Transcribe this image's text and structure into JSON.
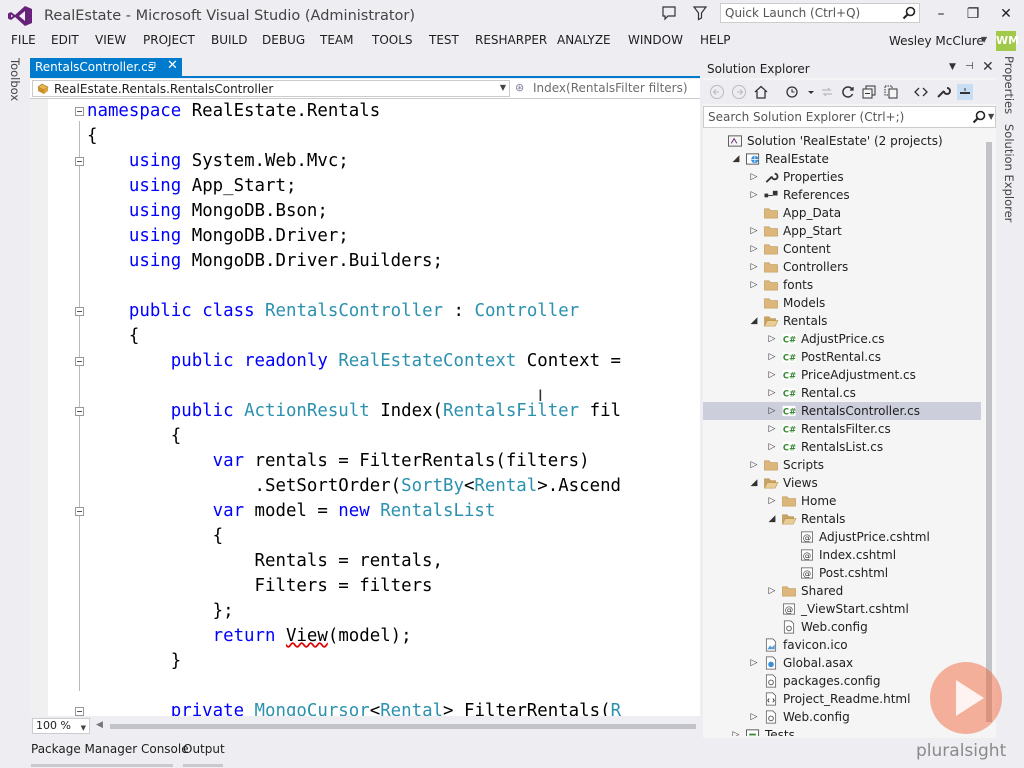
{
  "window": {
    "title": "RealEstate - Microsoft Visual Studio (Administrator)",
    "quick_launch_placeholder": "Quick Launch (Ctrl+Q)",
    "minimize": "–",
    "maximize": "❐",
    "close": "✕"
  },
  "menu": [
    "FILE",
    "EDIT",
    "VIEW",
    "PROJECT",
    "BUILD",
    "DEBUG",
    "TEAM",
    "TOOLS",
    "TEST",
    "RESHARPER",
    "ANALYZE",
    "WINDOW",
    "HELP"
  ],
  "user": {
    "name": "Wesley McClure",
    "initials": "WM"
  },
  "side_tabs": {
    "left": "Toolbox",
    "right_1": "Properties",
    "right_2": "Solution Explorer"
  },
  "document_tab": {
    "label": "RentalsController.cs",
    "pin": "⊐",
    "close": "✕"
  },
  "navbar": {
    "type": "RealEstate.Rentals.RentalsController",
    "member": "Index(RentalsFilter filters)"
  },
  "editor": {
    "zoom": "100 %",
    "lines": [
      [
        [
          "kw",
          "namespace"
        ],
        [
          "t",
          " RealEstate.Rentals"
        ]
      ],
      [
        [
          "t",
          "{"
        ]
      ],
      [
        [
          "t",
          "    "
        ],
        [
          "kw",
          "using"
        ],
        [
          "t",
          " System.Web.Mvc;"
        ]
      ],
      [
        [
          "t",
          "    "
        ],
        [
          "kw",
          "using"
        ],
        [
          "t",
          " App_Start;"
        ]
      ],
      [
        [
          "t",
          "    "
        ],
        [
          "kw",
          "using"
        ],
        [
          "t",
          " MongoDB.Bson;"
        ]
      ],
      [
        [
          "t",
          "    "
        ],
        [
          "kw",
          "using"
        ],
        [
          "t",
          " MongoDB.Driver;"
        ]
      ],
      [
        [
          "t",
          "    "
        ],
        [
          "kw",
          "using"
        ],
        [
          "t",
          " MongoDB.Driver.Builders;"
        ]
      ],
      [
        [
          "t",
          ""
        ]
      ],
      [
        [
          "t",
          "    "
        ],
        [
          "kw",
          "public"
        ],
        [
          "t",
          " "
        ],
        [
          "kw",
          "class"
        ],
        [
          "t",
          " "
        ],
        [
          "ty",
          "RentalsController"
        ],
        [
          "t",
          " : "
        ],
        [
          "ty",
          "Controller"
        ]
      ],
      [
        [
          "t",
          "    {"
        ]
      ],
      [
        [
          "t",
          "        "
        ],
        [
          "kw",
          "public"
        ],
        [
          "t",
          " "
        ],
        [
          "kw",
          "readonly"
        ],
        [
          "t",
          " "
        ],
        [
          "ty",
          "RealEstateContext"
        ],
        [
          "t",
          " Context ="
        ]
      ],
      [
        [
          "t",
          ""
        ]
      ],
      [
        [
          "t",
          "        "
        ],
        [
          "kw",
          "public"
        ],
        [
          "t",
          " "
        ],
        [
          "ty",
          "ActionResult"
        ],
        [
          "t",
          " Index("
        ],
        [
          "ty",
          "RentalsFilter"
        ],
        [
          "t",
          " fil"
        ]
      ],
      [
        [
          "t",
          "        {"
        ]
      ],
      [
        [
          "t",
          "            "
        ],
        [
          "kw",
          "var"
        ],
        [
          "t",
          " rentals = FilterRentals(filters)"
        ]
      ],
      [
        [
          "t",
          "                .SetSortOrder("
        ],
        [
          "ty",
          "SortBy"
        ],
        [
          "t",
          "<"
        ],
        [
          "ty",
          "Rental"
        ],
        [
          "t",
          ">.Ascend"
        ]
      ],
      [
        [
          "t",
          "            "
        ],
        [
          "kw",
          "var"
        ],
        [
          "t",
          " model = "
        ],
        [
          "kw",
          "new"
        ],
        [
          "t",
          " "
        ],
        [
          "ty",
          "RentalsList"
        ]
      ],
      [
        [
          "t",
          "            {"
        ]
      ],
      [
        [
          "t",
          "                Rentals = rentals,"
        ]
      ],
      [
        [
          "t",
          "                Filters = filters"
        ]
      ],
      [
        [
          "t",
          "            };"
        ]
      ],
      [
        [
          "t",
          "            "
        ],
        [
          "kw",
          "return"
        ],
        [
          "t",
          " "
        ],
        [
          "err",
          "View"
        ],
        [
          "t",
          "(model);"
        ]
      ],
      [
        [
          "t",
          "        }"
        ]
      ],
      [
        [
          "t",
          ""
        ]
      ],
      [
        [
          "t",
          "        "
        ],
        [
          "kw",
          "private"
        ],
        [
          "t",
          " "
        ],
        [
          "ty",
          "MongoCursor"
        ],
        [
          "t",
          "<"
        ],
        [
          "ty",
          "Rental"
        ],
        [
          "t",
          "> FilterRentals("
        ],
        [
          "ty",
          "R"
        ]
      ]
    ]
  },
  "bottom_tabs": [
    "Package Manager Console",
    "Output"
  ],
  "solution_explorer": {
    "title": "Solution Explorer",
    "search_placeholder": "Search Solution Explorer (Ctrl+;)",
    "items": [
      {
        "label": "Solution 'RealEstate' (2 projects)",
        "icon": "solution-icon",
        "arrow": ""
      },
      {
        "label": "RealEstate",
        "icon": "web-project-icon",
        "arrow": "expanded"
      },
      {
        "label": "Properties",
        "icon": "properties-icon",
        "arrow": "collapsed"
      },
      {
        "label": "References",
        "icon": "references-icon",
        "arrow": "collapsed"
      },
      {
        "label": "App_Data",
        "icon": "folder-icon",
        "arrow": ""
      },
      {
        "label": "App_Start",
        "icon": "folder-icon",
        "arrow": "collapsed"
      },
      {
        "label": "Content",
        "icon": "folder-icon",
        "arrow": "collapsed"
      },
      {
        "label": "Controllers",
        "icon": "folder-icon",
        "arrow": "collapsed"
      },
      {
        "label": "fonts",
        "icon": "folder-icon",
        "arrow": "collapsed"
      },
      {
        "label": "Models",
        "icon": "folder-icon",
        "arrow": ""
      },
      {
        "label": "Rentals",
        "icon": "folder-open-icon",
        "arrow": "expanded"
      },
      {
        "label": "AdjustPrice.cs",
        "icon": "csharp-file-icon",
        "arrow": "collapsed"
      },
      {
        "label": "PostRental.cs",
        "icon": "csharp-file-icon",
        "arrow": "collapsed"
      },
      {
        "label": "PriceAdjustment.cs",
        "icon": "csharp-file-icon",
        "arrow": "collapsed"
      },
      {
        "label": "Rental.cs",
        "icon": "csharp-file-icon",
        "arrow": "collapsed"
      },
      {
        "label": "RentalsController.cs",
        "icon": "csharp-file-icon",
        "arrow": "collapsed",
        "selected": true
      },
      {
        "label": "RentalsFilter.cs",
        "icon": "csharp-file-icon",
        "arrow": "collapsed"
      },
      {
        "label": "RentalsList.cs",
        "icon": "csharp-file-icon",
        "arrow": "collapsed"
      },
      {
        "label": "Scripts",
        "icon": "folder-icon",
        "arrow": "collapsed"
      },
      {
        "label": "Views",
        "icon": "folder-open-icon",
        "arrow": "expanded"
      },
      {
        "label": "Home",
        "icon": "folder-icon",
        "arrow": "collapsed"
      },
      {
        "label": "Rentals",
        "icon": "folder-open-icon",
        "arrow": "expanded"
      },
      {
        "label": "AdjustPrice.cshtml",
        "icon": "razor-file-icon",
        "arrow": ""
      },
      {
        "label": "Index.cshtml",
        "icon": "razor-file-icon",
        "arrow": ""
      },
      {
        "label": "Post.cshtml",
        "icon": "razor-file-icon",
        "arrow": ""
      },
      {
        "label": "Shared",
        "icon": "folder-icon",
        "arrow": "collapsed"
      },
      {
        "label": "_ViewStart.cshtml",
        "icon": "razor-file-icon",
        "arrow": ""
      },
      {
        "label": "Web.config",
        "icon": "config-file-icon",
        "arrow": ""
      },
      {
        "label": "favicon.ico",
        "icon": "image-file-icon",
        "arrow": ""
      },
      {
        "label": "Global.asax",
        "icon": "asax-file-icon",
        "arrow": "collapsed"
      },
      {
        "label": "packages.config",
        "icon": "config-file-icon",
        "arrow": ""
      },
      {
        "label": "Project_Readme.html",
        "icon": "html-file-icon",
        "arrow": ""
      },
      {
        "label": "Web.config",
        "icon": "config-file-icon",
        "arrow": "collapsed"
      },
      {
        "label": "Tests",
        "icon": "project-icon",
        "arrow": "collapsed"
      }
    ]
  },
  "watermark": {
    "brand": "pluralsight"
  },
  "colors": {
    "accent": "#007acc",
    "keyword": "#0000ff",
    "type": "#2b91af",
    "selection": "#cccedb",
    "brand": "#f15b2a"
  }
}
